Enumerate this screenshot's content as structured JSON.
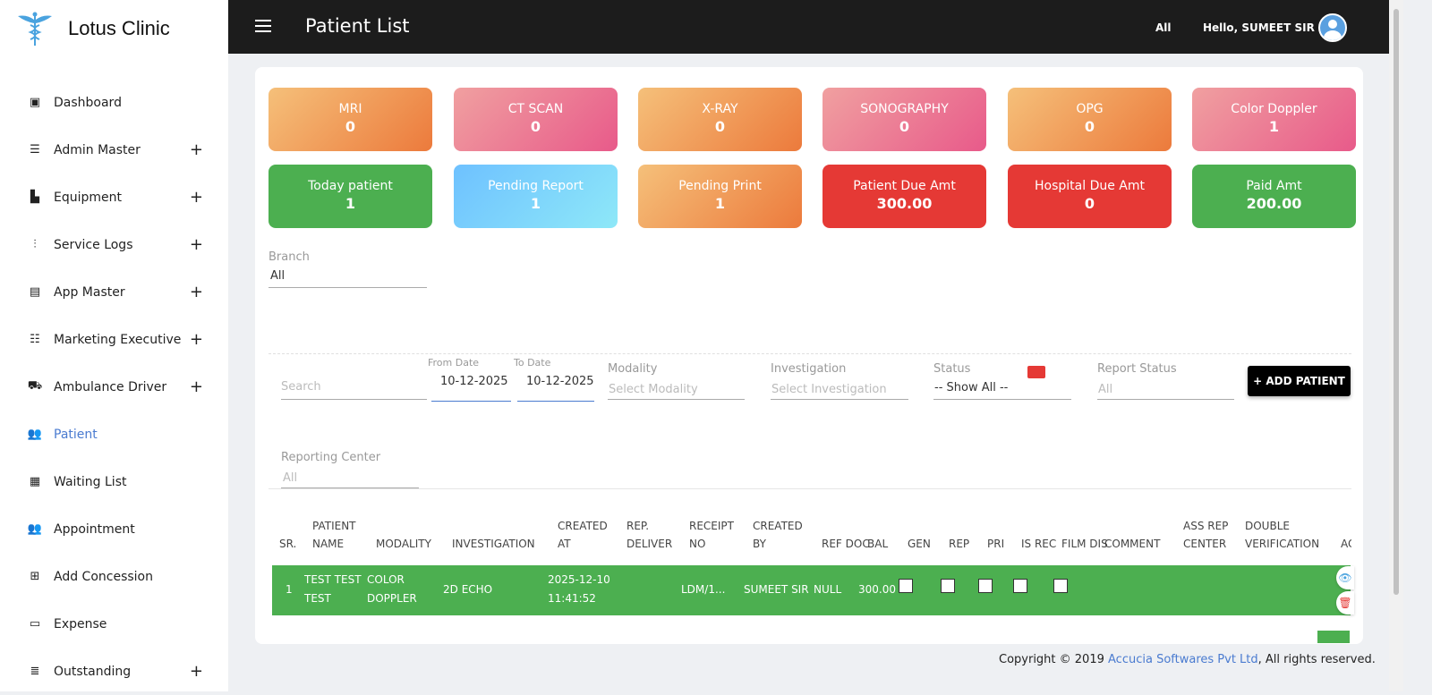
{
  "app": {
    "name": "Lotus Clinic",
    "logo_icon": "caduceus-icon"
  },
  "topbar": {
    "title": "Patient List",
    "branch": "All",
    "greeting": "Hello, SUMEET SIR"
  },
  "sidebar": {
    "items": [
      {
        "label": "Dashboard",
        "icon": "calendar-icon",
        "glyph": "▣",
        "expandable": false
      },
      {
        "label": "Admin Master",
        "icon": "list-icon",
        "glyph": "☰",
        "expandable": true
      },
      {
        "label": "Equipment",
        "icon": "boxes-icon",
        "glyph": "▙",
        "expandable": true
      },
      {
        "label": "Service Logs",
        "icon": "sliders-icon",
        "glyph": "⫶",
        "expandable": true
      },
      {
        "label": "App Master",
        "icon": "list-alt-icon",
        "glyph": "▤",
        "expandable": true
      },
      {
        "label": "Marketing Executive",
        "icon": "tasks-icon",
        "glyph": "☷",
        "expandable": true
      },
      {
        "label": "Ambulance Driver",
        "icon": "ambulance-icon",
        "glyph": "⛟",
        "expandable": true
      },
      {
        "label": "Patient",
        "icon": "users-icon",
        "glyph": "👥",
        "expandable": false,
        "active": true
      },
      {
        "label": "Waiting List",
        "icon": "grid-icon",
        "glyph": "▦",
        "expandable": false
      },
      {
        "label": "Appointment",
        "icon": "users-icon",
        "glyph": "👥",
        "expandable": false
      },
      {
        "label": "Add Concession",
        "icon": "plus-square-icon",
        "glyph": "⊞",
        "expandable": false
      },
      {
        "label": "Expense",
        "icon": "id-card-icon",
        "glyph": "▭",
        "expandable": false
      },
      {
        "label": "Outstanding",
        "icon": "server-icon",
        "glyph": "≣",
        "expandable": true
      }
    ]
  },
  "stats": [
    {
      "label": "MRI",
      "value": "0",
      "color": "orange"
    },
    {
      "label": "CT SCAN",
      "value": "0",
      "color": "pink"
    },
    {
      "label": "X-RAY",
      "value": "0",
      "color": "orange"
    },
    {
      "label": "SONOGRAPHY",
      "value": "0",
      "color": "pink"
    },
    {
      "label": "OPG",
      "value": "0",
      "color": "orange"
    },
    {
      "label": "Color Doppler",
      "value": "1",
      "color": "pink"
    },
    {
      "label": "Today patient",
      "value": "1",
      "color": "green"
    },
    {
      "label": "Pending Report",
      "value": "1",
      "color": "blue"
    },
    {
      "label": "Pending Print",
      "value": "1",
      "color": "orange"
    },
    {
      "label": "Patient Due Amt",
      "value": "300.00",
      "color": "red"
    },
    {
      "label": "Hospital Due Amt",
      "value": "0",
      "color": "red"
    },
    {
      "label": "Paid Amt",
      "value": "200.00",
      "color": "green"
    }
  ],
  "filters": {
    "branch": {
      "label": "Branch",
      "value": "All"
    },
    "search": {
      "placeholder": "Search"
    },
    "from_date": {
      "label": "From Date",
      "value": "10-12-2025"
    },
    "to_date": {
      "label": "To Date",
      "value": "10-12-2025"
    },
    "modality": {
      "label": "Modality",
      "placeholder": "Select Modality"
    },
    "investigation": {
      "label": "Investigation",
      "placeholder": "Select Investigation"
    },
    "status": {
      "label": "Status",
      "value": "-- Show All --"
    },
    "report_status": {
      "label": "Report Status",
      "placeholder": "All"
    },
    "reporting_center": {
      "label": "Reporting Center",
      "placeholder": "All"
    },
    "add_patient": "+ ADD PATIENT"
  },
  "table": {
    "headers": [
      "SR.",
      "PATIENT NAME",
      "MODALITY",
      "INVESTIGATION",
      "CREATED AT",
      "REP. DELIVER",
      "RECEIPT NO",
      "CREATED BY",
      "REF DOC",
      "BAL",
      "GEN",
      "REP",
      "PRI",
      "IS REC",
      "FILM DIS",
      "COMMENT",
      "ASS REP CENTER",
      "DOUBLE VERIFICATION",
      "AC"
    ],
    "rows": [
      {
        "sr": "1",
        "patient_name": "TEST TEST TEST",
        "modality": "COLOR DOPPLER",
        "investigation": "2D ECHO",
        "created_at": "2025-12-10 11:41:52",
        "rep_deliver": "",
        "receipt_no": "LDM/1...",
        "created_by": "SUMEET SIR",
        "ref_doc": "NULL",
        "bal": "300.00",
        "row_color": "#4caf50"
      }
    ]
  },
  "footer": {
    "prefix": "Copyright © 2019 ",
    "company": "Accucia Softwares Pvt Ltd",
    "suffix": ", All rights reserved."
  }
}
